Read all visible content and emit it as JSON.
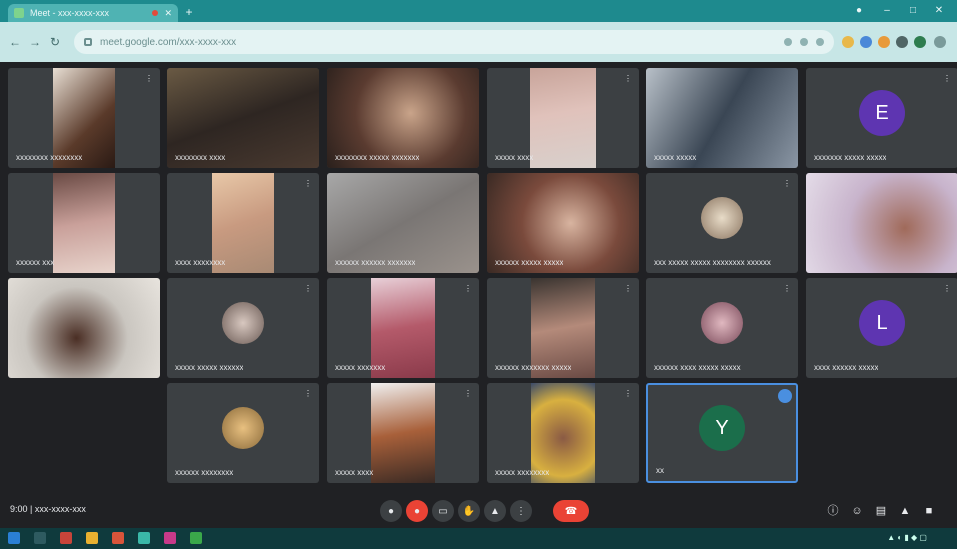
{
  "browser": {
    "tab_title": "Meet - xxx-xxxx-xxx",
    "url": "meet.google.com/xxx-xxxx-xxx",
    "colors": {
      "tab_bar": "#1e8a8e",
      "address_bar": "#c7e6e6"
    }
  },
  "participants": [
    {
      "name": "xxxxxxxx xxxxxxxx",
      "kind": "video"
    },
    {
      "name": "xxxxxxxx xxxx",
      "kind": "video"
    },
    {
      "name": "xxxxxxxx xxxxx xxxxxxx",
      "kind": "video"
    },
    {
      "name": "xxxxx xxxx",
      "kind": "video"
    },
    {
      "name": "xxxxx xxxxx",
      "kind": "video"
    },
    {
      "name": "xxxxxxx xxxxx xxxxx",
      "kind": "avatar",
      "initial": "E",
      "color": "#5e35b1"
    },
    {
      "name": "xxxxxx xxx",
      "kind": "video"
    },
    {
      "name": "xxxx xxxxxxxx",
      "kind": "video"
    },
    {
      "name": "xxxxxx xxxxxx xxxxxxx",
      "kind": "video"
    },
    {
      "name": "xxxxxx xxxxx xxxxx",
      "kind": "video"
    },
    {
      "name": "xxx xxxxx xxxxx xxxxxxxx xxxxxx",
      "kind": "photo"
    },
    {
      "name": "",
      "kind": "video"
    },
    {
      "name": "",
      "kind": "video"
    },
    {
      "name": "xxxxx xxxxx xxxxxx",
      "kind": "photo"
    },
    {
      "name": "xxxxx xxxxxxx",
      "kind": "video"
    },
    {
      "name": "xxxxxx xxxxxxx xxxxx",
      "kind": "video"
    },
    {
      "name": "xxxxxx xxxx xxxxx xxxxx",
      "kind": "photo"
    },
    {
      "name": "xxxx xxxxxx xxxxx",
      "kind": "avatar",
      "initial": "L",
      "color": "#5e35b1"
    },
    {
      "name": "xxxxxx xxxxxxxx",
      "kind": "photo"
    },
    {
      "name": "xxxxx xxxx",
      "kind": "video"
    },
    {
      "name": "xxxxx xxxxxxxx",
      "kind": "video"
    },
    {
      "name": "xx",
      "kind": "avatar",
      "initial": "Y",
      "color": "#1b6e4b"
    }
  ],
  "controls": {
    "meeting_info": "9:00 | xxx-xxxx-xxx",
    "end_call_color": "#ea4335"
  },
  "icons": [
    "mic-icon",
    "camera-icon",
    "captions-icon",
    "raise-hand-icon",
    "present-icon",
    "more-icon",
    "end-call-icon",
    "info-icon",
    "people-icon",
    "chat-icon",
    "activities-icon",
    "lock-icon"
  ]
}
